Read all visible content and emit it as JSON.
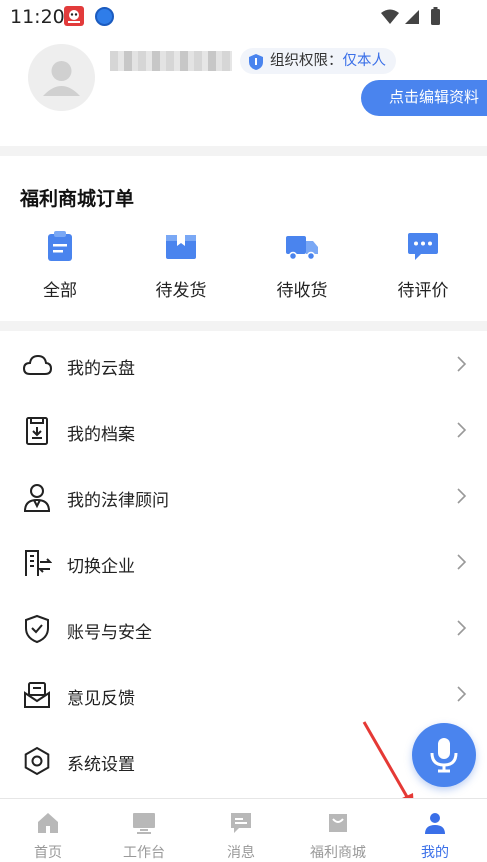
{
  "status_bar": {
    "time": "11:20"
  },
  "profile": {
    "permission_label": "组织权限：",
    "permission_value": "仅本人",
    "edit_button": "点击编辑资料"
  },
  "orders": {
    "title": "福利商城订单",
    "items": [
      {
        "label": "全部",
        "icon": "clipboard-icon"
      },
      {
        "label": "待发货",
        "icon": "box-icon"
      },
      {
        "label": "待收货",
        "icon": "truck-icon"
      },
      {
        "label": "待评价",
        "icon": "chat-bubble-icon"
      }
    ]
  },
  "menu": {
    "items": [
      {
        "label": "我的云盘",
        "icon": "cloud-icon"
      },
      {
        "label": "我的档案",
        "icon": "archive-icon"
      },
      {
        "label": "我的法律顾问",
        "icon": "lawyer-icon"
      },
      {
        "label": "切换企业",
        "icon": "switch-enterprise-icon"
      },
      {
        "label": "账号与安全",
        "icon": "shield-check-icon"
      },
      {
        "label": "意见反馈",
        "icon": "feedback-icon"
      },
      {
        "label": "系统设置",
        "icon": "settings-icon"
      }
    ]
  },
  "tab_bar": {
    "tabs": [
      {
        "label": "首页",
        "icon": "home-icon",
        "active": false
      },
      {
        "label": "工作台",
        "icon": "desktop-icon",
        "active": false
      },
      {
        "label": "消息",
        "icon": "message-icon",
        "active": false
      },
      {
        "label": "福利商城",
        "icon": "mall-icon",
        "active": false
      },
      {
        "label": "我的",
        "icon": "user-icon",
        "active": true
      }
    ]
  },
  "colors": {
    "accent": "#4a84ee",
    "link": "#3a6fe8",
    "annotation_arrow": "#e53935"
  }
}
